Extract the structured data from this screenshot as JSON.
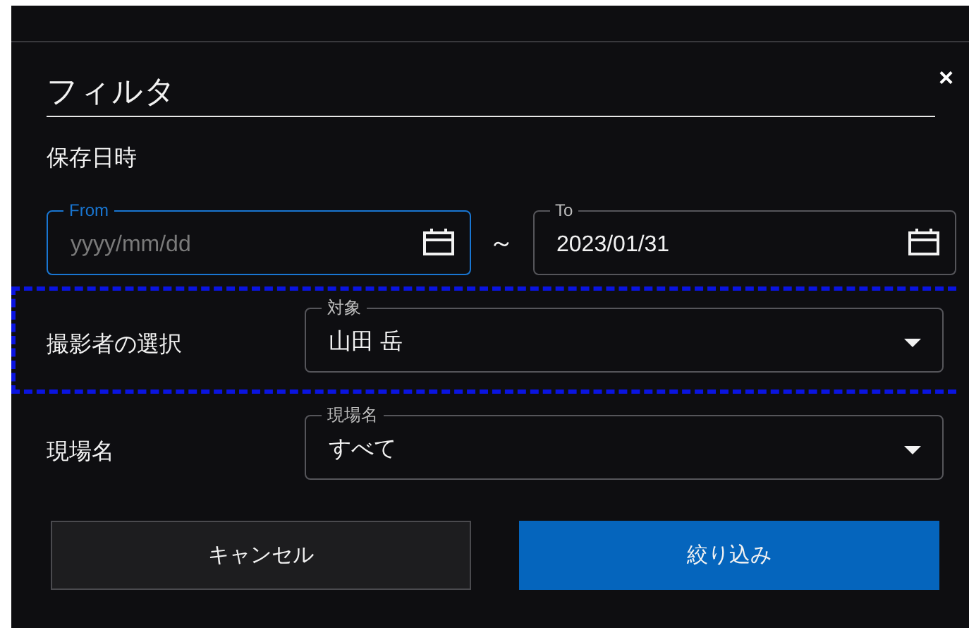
{
  "dialog": {
    "title": "フィルタ",
    "close": "×"
  },
  "date_range": {
    "label": "保存日時",
    "separator": "～",
    "fields": [
      {
        "label": "From",
        "placeholder": "yyyy/mm/dd",
        "focused": true
      },
      {
        "label": "To",
        "value": "2023/01/31",
        "focused": false
      }
    ]
  },
  "selects": [
    {
      "label": "撮影者の選択",
      "floating_label": "対象",
      "value": "山田 岳",
      "highlighted": true
    },
    {
      "label": "現場名",
      "floating_label": "現場名",
      "value": "すべて",
      "highlighted": false
    }
  ],
  "buttons": [
    {
      "label": "キャンセル",
      "kind": "secondary"
    },
    {
      "label": "絞り込み",
      "kind": "primary"
    }
  ]
}
